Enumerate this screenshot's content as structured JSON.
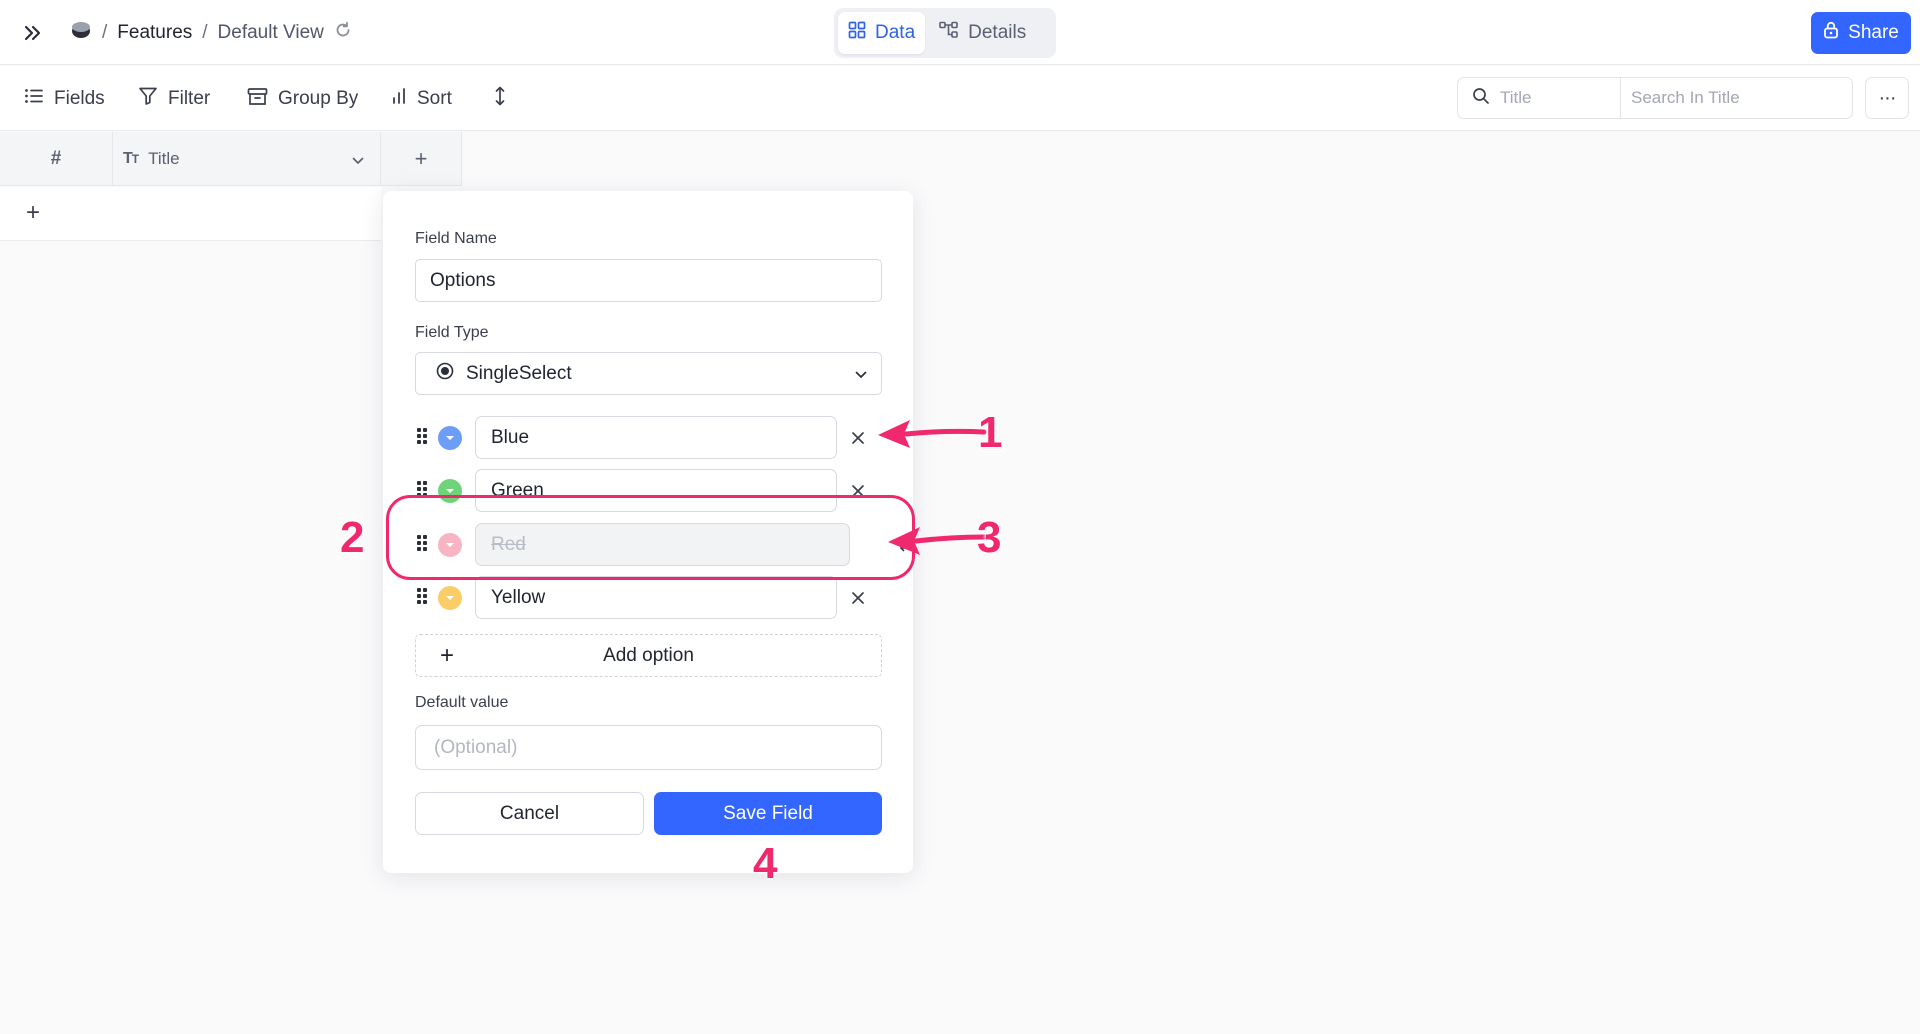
{
  "topbar": {
    "breadcrumb_sep": "/",
    "base_name": "Features",
    "view_sep": "/",
    "view_name": "Default View",
    "tabs": [
      {
        "label": "Data",
        "active": true
      },
      {
        "label": "Details",
        "active": false
      }
    ],
    "share_label": "Share"
  },
  "toolbar": {
    "fields_label": "Fields",
    "filter_label": "Filter",
    "group_by_label": "Group By",
    "sort_label": "Sort",
    "search_field_label": "Title",
    "search_placeholder": "Search In Title",
    "more_label": "···"
  },
  "grid": {
    "number_col": "#",
    "title_col": "Title",
    "add_col": "+",
    "add_row": "+"
  },
  "modal": {
    "field_name_label": "Field Name",
    "field_name_value": "Options",
    "field_type_label": "Field Type",
    "field_type_value": "SingleSelect",
    "options": [
      {
        "label": "Blue",
        "color": "#6c9ef8",
        "deleted": false
      },
      {
        "label": "Green",
        "color": "#6fd37a",
        "deleted": false
      },
      {
        "label": "Red",
        "color": "#f27a95",
        "deleted": true
      },
      {
        "label": "Yellow",
        "color": "#fbcd67",
        "deleted": false
      }
    ],
    "add_option_label": "Add option",
    "default_value_label": "Default value",
    "default_value_placeholder": "(Optional)",
    "cancel_label": "Cancel",
    "save_label": "Save Field"
  },
  "annotations": {
    "accent_color": "#f0286e",
    "numbers": [
      "1",
      "2",
      "3",
      "4"
    ]
  }
}
